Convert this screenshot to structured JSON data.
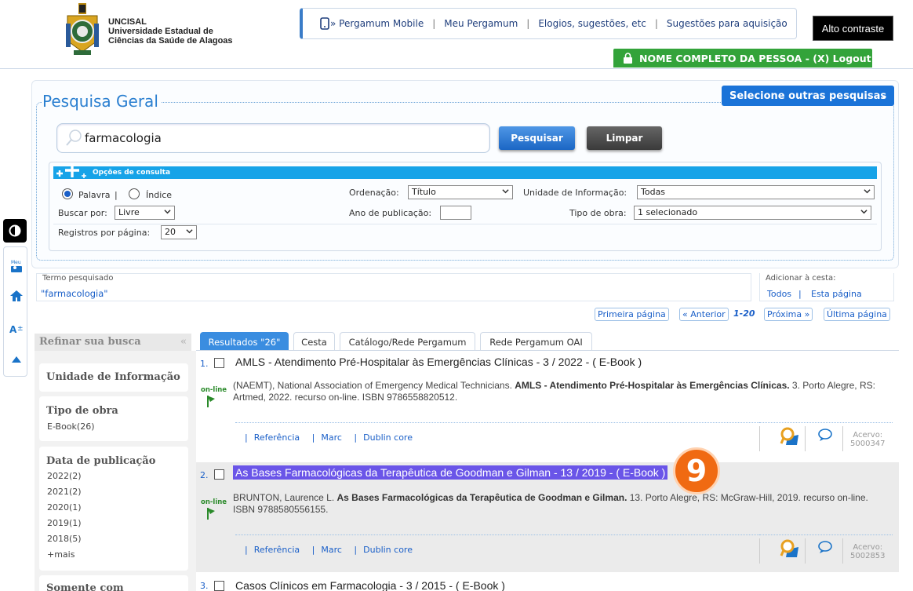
{
  "header": {
    "institution_acronym": "UNCISAL",
    "institution_line1": "Universidade Estadual de",
    "institution_line2": "Ciências da Saúde de Alagoas",
    "nav": [
      "» Pergamum Mobile",
      "Meu Pergamum",
      "Elogios, sugestões, etc",
      "Sugestões para aquisição"
    ],
    "alto_contraste": "Alto contraste",
    "user": "NOME COMPLETO DA PESSOA - (X) Logout"
  },
  "sidetools": {
    "contrast_icon": "contrast-icon",
    "items": [
      "meu-pergamum-icon",
      "home-icon",
      "font-size-icon",
      "scroll-top-icon"
    ],
    "meu_label": "Meu"
  },
  "search": {
    "legend": "Pesquisa Geral",
    "other_searches": "Selecione outras pesquisas",
    "value": "farmacologia",
    "btn_search": "Pesquisar",
    "btn_clear": "Limpar"
  },
  "options": {
    "header": "Opções de consulta",
    "radio_palavra": "Palavra",
    "radio_sep": "|",
    "radio_indice": "Índice",
    "buscar_por_label": "Buscar por:",
    "buscar_por_value": "Livre",
    "registros_label": "Registros por página:",
    "registros_value": "20",
    "ordenacao_label": "Ordenação:",
    "ordenacao_value": "Título",
    "ano_label": "Ano de publicação:",
    "unidade_label": "Unidade de Informação:",
    "unidade_value": "Todas",
    "tipo_label": "Tipo de obra:",
    "tipo_value": "1 selecionado"
  },
  "termo": {
    "label": "Termo pesquisado",
    "value": "\"farmacologia\"",
    "cesta_label": "Adicionar à cesta:",
    "cesta_todos": "Todos",
    "cesta_sep": "|",
    "cesta_pagina": "Esta página"
  },
  "pager": {
    "first": "Primeira página",
    "prev": "« Anterior",
    "range": "1-20",
    "next": "Próxima »",
    "last": "Última página"
  },
  "refine": {
    "title": "Refinar sua busca",
    "unidade": "Unidade de Informação",
    "tipo_title": "Tipo de obra",
    "tipo_items": [
      "E-Book(26)"
    ],
    "data_title": "Data de publicação",
    "data_items": [
      "2022(2)",
      "2021(2)",
      "2020(1)",
      "2019(1)",
      "2018(5)",
      "+mais"
    ],
    "next_title": "Somente com"
  },
  "tabs": [
    "Resultados \"26\"",
    "Cesta",
    "Catálogo/Rede Pergamum",
    "Rede Pergamum OAI"
  ],
  "results": [
    {
      "num": "1.",
      "title": "AMLS - Atendimento Pré-Hospitalar às Emergências Clínicas - 3 / 2022 - ( E-Book )",
      "desc_pre": "(NAEMT), National Association of Emergency Medical Technicians. ",
      "desc_bold": "AMLS - Atendimento Pré-Hospitalar às Emergências Clínicas.",
      "desc_post": " 3. Porto Alegre, RS: Artmed, 2022. recurso on-line. ISBN 9786558820512.",
      "acervo_label": "Acervo:",
      "acervo": "5000347"
    },
    {
      "num": "2.",
      "title": "As Bases Farmacológicas da Terapêutica de Goodman e Gilman - 13 / 2019 - ( E-Book )",
      "desc_pre": "BRUNTON, Laurence L. ",
      "desc_bold": "As Bases Farmacológicas da Terapêutica de Goodman e Gilman.",
      "desc_post": " 13. Porto Alegre, RS: McGraw-Hill, 2019. recurso on-line. ISBN 9788580556155.",
      "acervo_label": "Acervo:",
      "acervo": "5002853"
    },
    {
      "num": "3.",
      "title": "Casos Clínicos em Farmacologia - 3 / 2015 - ( E-Book )"
    }
  ],
  "result_links": {
    "ref": "Referência",
    "marc": "Marc",
    "dublin": "Dublin core",
    "sep": "|"
  },
  "online_label": "on-line",
  "badge": "9",
  "colors": {
    "accent": "#1a73d8",
    "user_bar": "#33a33a",
    "highlight": "#6a55e8",
    "badge": "#f06a12"
  }
}
